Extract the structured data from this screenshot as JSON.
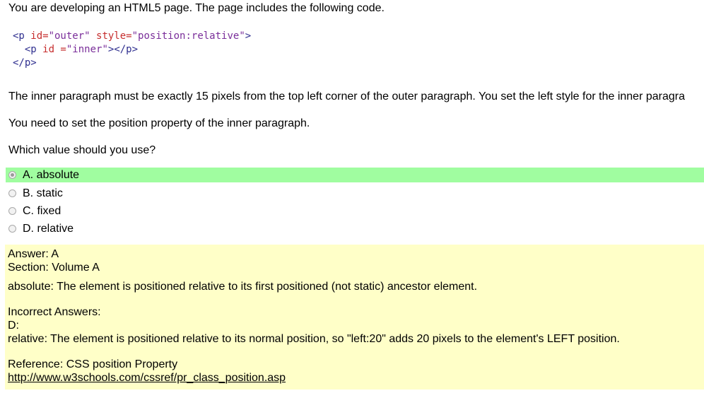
{
  "question": {
    "intro": "You are developing an HTML5 page. The page includes the following code.",
    "code": {
      "line1": {
        "open": "<p",
        "attr1": " id=",
        "val1": "\"outer\"",
        "attr2": " style=",
        "val2": "\"position:relative\"",
        "close": ">"
      },
      "line2": {
        "indent": "  ",
        "open": "<p",
        "attr1": " id =",
        "val1": "\"inner\"",
        "close": "></p>"
      },
      "line3": {
        "tag": "</p>"
      }
    },
    "para1": "The inner paragraph must be exactly 15 pixels from the top left corner of the outer paragraph. You set the left style for the inner paragra",
    "para2": "You need to set the position property of the inner paragraph.",
    "prompt": "Which value should you use?"
  },
  "options": [
    {
      "label": "A. absolute",
      "selected": true
    },
    {
      "label": "B. static",
      "selected": false
    },
    {
      "label": "C. fixed",
      "selected": false
    },
    {
      "label": "D. relative",
      "selected": false
    }
  ],
  "answer": {
    "answer_line": "Answer: A",
    "section_line": "Section: Volume A",
    "explanation": "absolute: The element is positioned relative to its first positioned (not static) ancestor element.",
    "incorrect_heading": "Incorrect Answers:",
    "incorrect_letter": "D:",
    "incorrect_text": "relative: The element is positioned relative to its normal position, so \"left:20\" adds 20 pixels to the element's LEFT position.",
    "reference": "Reference: CSS position Property",
    "link": "http://www.w3schools.com/cssref/pr_class_position.asp"
  },
  "colors": {
    "correct_highlight": "#a0fda0",
    "answer_background": "#ffffc8"
  }
}
